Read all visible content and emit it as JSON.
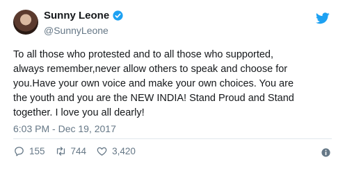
{
  "author": {
    "display_name": "Sunny Leone",
    "handle": "@SunnyLeone",
    "verified": true
  },
  "tweet": {
    "text": "To all those who protested and to all those who supported,\nalways remember,never allow others to speak and choose for\nyou.Have your own voice and make your own choices. You are\nthe youth and you are the NEW INDIA! Stand Proud and Stand\ntogether. I love you all dearly!",
    "timestamp": "6:03 PM - Dec 19, 2017"
  },
  "actions": {
    "replies": "155",
    "retweets": "744",
    "likes": "3,420"
  },
  "colors": {
    "brand": "#1da1f2",
    "secondary_text": "#657786",
    "divider": "#e1e8ed"
  },
  "icons": [
    "verified-icon",
    "twitter-bird-icon",
    "reply-icon",
    "retweet-icon",
    "like-icon",
    "info-icon"
  ]
}
